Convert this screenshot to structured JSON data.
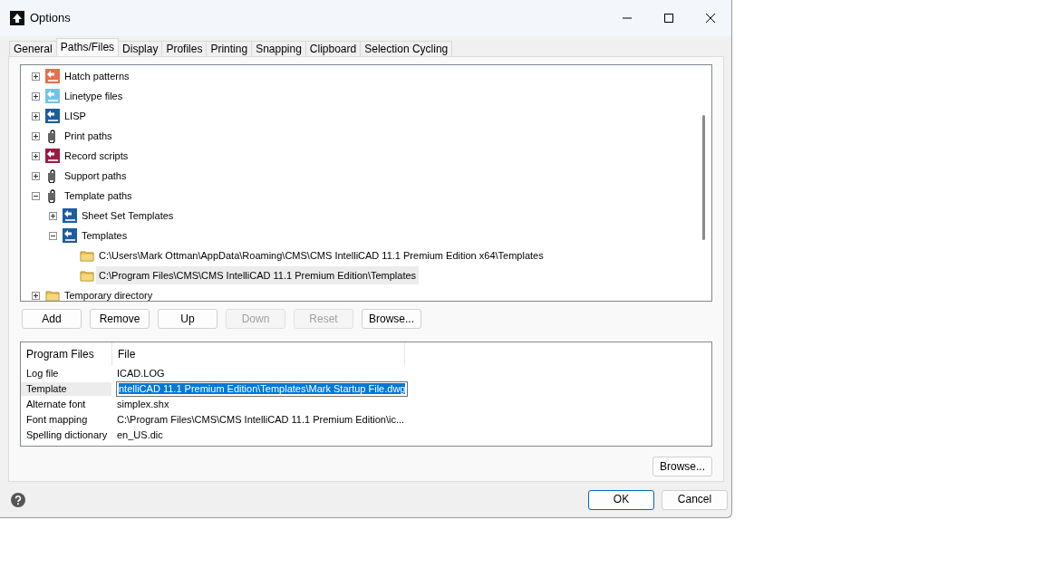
{
  "window": {
    "title": "Options"
  },
  "tabs": [
    {
      "label": "General",
      "selected": false
    },
    {
      "label": "Paths/Files",
      "selected": true
    },
    {
      "label": "Display",
      "selected": false
    },
    {
      "label": "Profiles",
      "selected": false
    },
    {
      "label": "Printing",
      "selected": false
    },
    {
      "label": "Snapping",
      "selected": false
    },
    {
      "label": "Clipboard",
      "selected": false
    },
    {
      "label": "Selection Cycling",
      "selected": false
    }
  ],
  "tree": {
    "items": [
      {
        "label": "Hatch patterns",
        "kind": "pat",
        "expanded": false,
        "selected": false
      },
      {
        "label": "Linetype files",
        "kind": "lin",
        "expanded": false,
        "selected": false
      },
      {
        "label": "LISP",
        "kind": "lsp",
        "expanded": false,
        "selected": false
      },
      {
        "label": "Print paths",
        "kind": "clip",
        "expanded": false,
        "selected": false
      },
      {
        "label": "Record scripts",
        "kind": "scr",
        "expanded": false,
        "selected": false
      },
      {
        "label": "Support paths",
        "kind": "clip",
        "expanded": false,
        "selected": false
      },
      {
        "label": "Template paths",
        "kind": "clip",
        "expanded": true,
        "selected": false,
        "children": [
          {
            "label": "Sheet Set Templates",
            "kind": "dwt",
            "expanded": false,
            "selected": false
          },
          {
            "label": "Templates",
            "kind": "dwt",
            "expanded": true,
            "selected": false,
            "children": [
              {
                "label": "C:\\Users\\Mark Ottman\\AppData\\Roaming\\CMS\\CMS IntelliCAD 11.1 Premium Edition x64\\Templates",
                "kind": "folder",
                "selected": false
              },
              {
                "label": "C:\\Program Files\\CMS\\CMS IntelliCAD 11.1 Premium Edition\\Templates",
                "kind": "folder",
                "selected": true
              }
            ]
          }
        ]
      },
      {
        "label": "Temporary directory",
        "kind": "folder",
        "expanded": false,
        "selected": false
      }
    ]
  },
  "tree_buttons": [
    {
      "label": "Add",
      "disabled": false
    },
    {
      "label": "Remove",
      "disabled": false
    },
    {
      "label": "Up",
      "disabled": false
    },
    {
      "label": "Down",
      "disabled": true
    },
    {
      "label": "Reset",
      "disabled": true
    },
    {
      "label": "Browse...",
      "disabled": false
    }
  ],
  "file_table": {
    "columns": [
      "Program Files",
      "File"
    ],
    "rows": [
      {
        "name": "Log file",
        "value": "ICAD.LOG",
        "selected": false
      },
      {
        "name": "Template",
        "value": "ntelliCAD 11.1 Premium Edition\\Templates\\Mark Startup File.dwg",
        "selected": true
      },
      {
        "name": "Alternate font",
        "value": "simplex.shx",
        "selected": false
      },
      {
        "name": "Font mapping",
        "value": "C:\\Program Files\\CMS\\CMS IntelliCAD 11.1 Premium Edition\\ic...",
        "selected": false
      },
      {
        "name": "Spelling dictionary",
        "value": "en_US.dic",
        "selected": false
      }
    ]
  },
  "browse_button": "Browse...",
  "footer_buttons": [
    {
      "label": "OK",
      "default": true
    },
    {
      "label": "Cancel",
      "default": false
    }
  ]
}
